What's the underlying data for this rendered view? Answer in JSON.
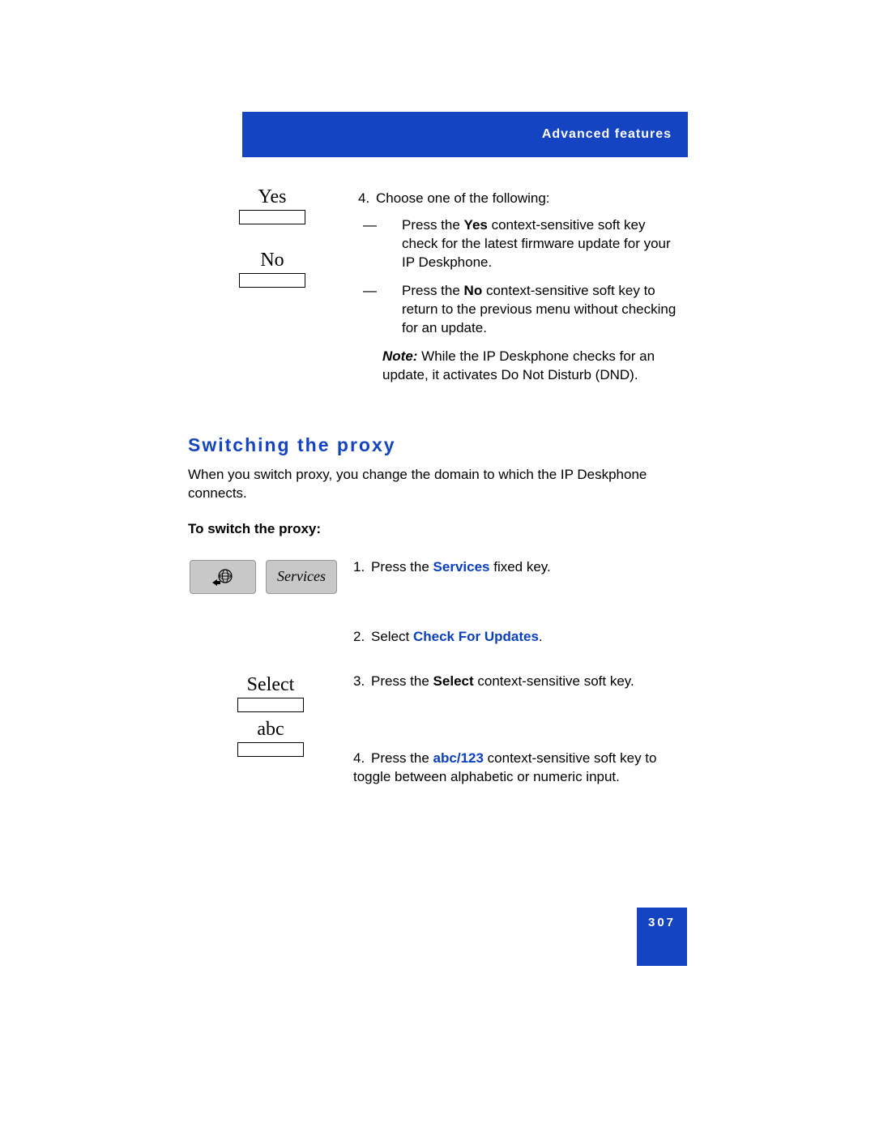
{
  "header": {
    "title": "Advanced features"
  },
  "section1": {
    "softkey_yes": "Yes",
    "softkey_no": "No",
    "step4_num": "4.",
    "step4_intro": "Choose one of the following:",
    "dash": "—",
    "bullet1_pre": "Press the ",
    "bullet1_bold": "Yes",
    "bullet1_post": " context-sensitive soft key check for the latest firmware update for your IP Deskphone.",
    "bullet2_pre": "Press the ",
    "bullet2_bold": "No",
    "bullet2_post": " context-sensitive soft key to return to the previous menu without checking for an update.",
    "note_label": "Note:",
    "note_text": "  While the IP Deskphone checks for an update, it activates Do Not Disturb (DND)."
  },
  "section2": {
    "heading": "Switching the proxy",
    "intro": "When you switch proxy, you change the domain to which the IP Deskphone connects.",
    "subheading": "To switch the proxy:",
    "services_label": "Services",
    "step1_num": "1.",
    "step1_pre": "Press the ",
    "step1_bold": "Services",
    "step1_post": " fixed key.",
    "step2_num": "2.",
    "step2_pre": "Select ",
    "step2_bold": "Check For Updates",
    "step2_post": ".",
    "softkey_select": "Select",
    "step3_num": "3.",
    "step3_pre": "Press the ",
    "step3_bold": "Select",
    "step3_post": " context-sensitive soft key.",
    "softkey_abc": "abc",
    "step4_num": "4.",
    "step4_pre": "Press the ",
    "step4_bold": "abc/123",
    "step4_post": " context-sensitive soft key to toggle between alphabetic or numeric input."
  },
  "footer": {
    "page_number": "307"
  }
}
